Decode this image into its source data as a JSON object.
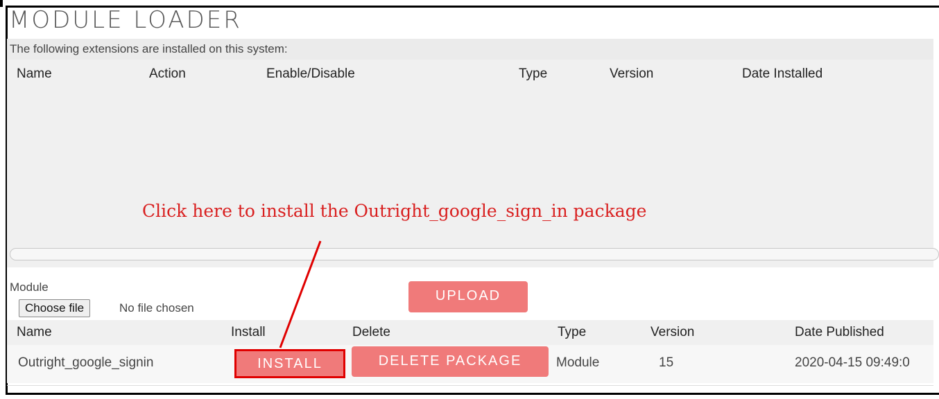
{
  "page": {
    "title": "MODULE LOADER",
    "subtitle": "The following extensions are installed on this system:"
  },
  "installed_table": {
    "headers": [
      "Name",
      "Action",
      "Enable/Disable",
      "Type",
      "Version",
      "Date Installed"
    ]
  },
  "annotation": {
    "text": "Click here to install the Outright_google_sign_in package",
    "color": "#d92020"
  },
  "upload": {
    "module_label": "Module",
    "choose_file_label": "Choose file",
    "no_file_text": "No file chosen",
    "upload_label": "UPLOAD"
  },
  "packages_table": {
    "headers": [
      "Name",
      "Install",
      "Delete",
      "Type",
      "Version",
      "Date Published"
    ],
    "rows": [
      {
        "name": "Outright_google_signin",
        "install_label": "INSTALL",
        "delete_label": "DELETE PACKAGE",
        "type": "Module",
        "version": "15",
        "date_published": "2020-04-15 09:49:0"
      }
    ]
  },
  "colors": {
    "button_bg": "#f07a7a",
    "highlight_border": "#e00000"
  }
}
